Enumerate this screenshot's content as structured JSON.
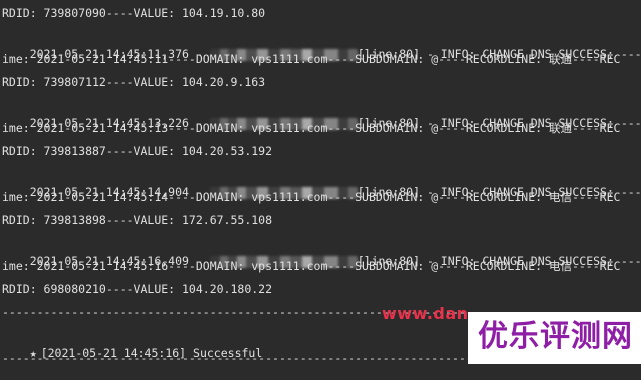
{
  "terminal": {
    "lines": [
      "RDID: 739807090----VALUE: 104.19.10.80",
      "2021-05-21 14:45:11,376 - ",
      "ime: 2021-05-21 14:45:11----DOMAIN: vps1111.com----SUBDOMAIN: @----RECORDLINE: 联通----REC",
      "RDID: 739807112----VALUE: 104.20.9.163",
      "2021-05-21 14:45:13,226 - ",
      "ime: 2021-05-21 14:45:13----DOMAIN: vps1111.com----SUBDOMAIN: @----RECORDLINE: 联通----REC",
      "RDID: 739813887----VALUE: 104.20.53.192",
      "2021-05-21 14:45:14,904 - ",
      "ime: 2021-05-21 14:45:14----DOMAIN: vps1111.com----SUBDOMAIN: @----RECORDLINE: 电信----REC",
      "RDID: 739813898----VALUE: 172.67.55.108",
      "2021-05-21 14:45:16,409 - ",
      "ime: 2021-05-21 14:45:16----DOMAIN: vps1111.com----SUBDOMAIN: @----RECORDLINE: 电信----REC",
      "RDID: 698080210----VALUE: 104.20.180.22",
      "--------------------------------------------------------------------------",
      "[2021-05-21 14:45:16] Successful",
      "--------------------------------------------------------------------------"
    ],
    "info_suffix": "[line:80] - INFO: CHANGE DNS SUCCESS: ----",
    "star_glyph": "★"
  },
  "watermark": {
    "url_text": "www.dan",
    "brand_text": "优乐评测网"
  },
  "colors": {
    "background": "#2b2b2b",
    "text": "#e0e0e0",
    "watermark_red": "#e8314a",
    "watermark_purple": "#8e1ea6"
  }
}
